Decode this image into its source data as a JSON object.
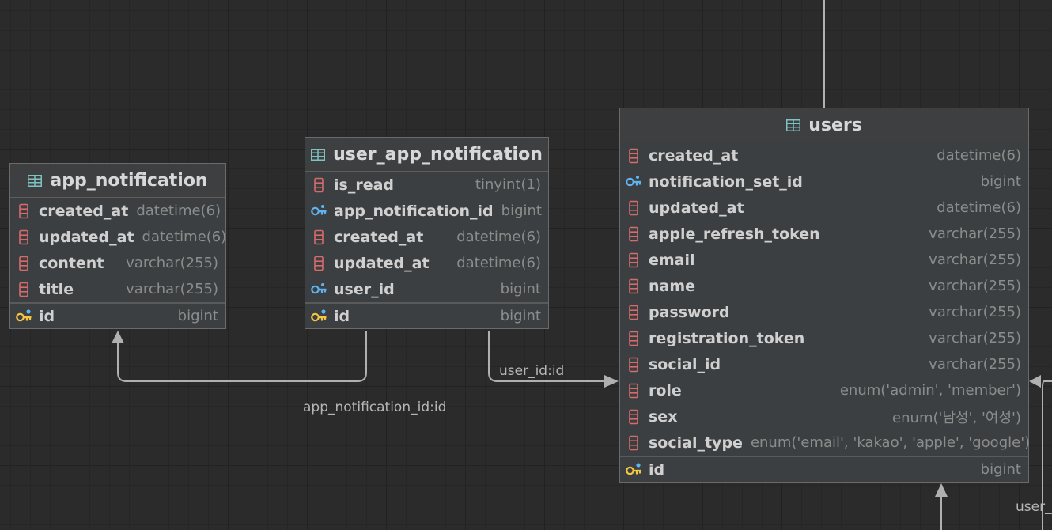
{
  "tables": {
    "app_notification": {
      "title": "app_notification",
      "columns": [
        {
          "name": "created_at",
          "type": "datetime(6)",
          "kind": "column"
        },
        {
          "name": "updated_at",
          "type": "datetime(6)",
          "kind": "column"
        },
        {
          "name": "content",
          "type": "varchar(255)",
          "kind": "column"
        },
        {
          "name": "title",
          "type": "varchar(255)",
          "kind": "column"
        }
      ],
      "pk": {
        "name": "id",
        "type": "bigint"
      }
    },
    "user_app_notification": {
      "title": "user_app_notification",
      "columns": [
        {
          "name": "is_read",
          "type": "tinyint(1)",
          "kind": "column"
        },
        {
          "name": "app_notification_id",
          "type": "bigint",
          "kind": "fk"
        },
        {
          "name": "created_at",
          "type": "datetime(6)",
          "kind": "column"
        },
        {
          "name": "updated_at",
          "type": "datetime(6)",
          "kind": "column"
        },
        {
          "name": "user_id",
          "type": "bigint",
          "kind": "fk"
        }
      ],
      "pk": {
        "name": "id",
        "type": "bigint"
      }
    },
    "users": {
      "title": "users",
      "columns": [
        {
          "name": "created_at",
          "type": "datetime(6)",
          "kind": "column"
        },
        {
          "name": "notification_set_id",
          "type": "bigint",
          "kind": "fk"
        },
        {
          "name": "updated_at",
          "type": "datetime(6)",
          "kind": "column"
        },
        {
          "name": "apple_refresh_token",
          "type": "varchar(255)",
          "kind": "column"
        },
        {
          "name": "email",
          "type": "varchar(255)",
          "kind": "column"
        },
        {
          "name": "name",
          "type": "varchar(255)",
          "kind": "column"
        },
        {
          "name": "password",
          "type": "varchar(255)",
          "kind": "column"
        },
        {
          "name": "registration_token",
          "type": "varchar(255)",
          "kind": "column"
        },
        {
          "name": "social_id",
          "type": "varchar(255)",
          "kind": "column"
        },
        {
          "name": "role",
          "type": "enum('admin', 'member')",
          "kind": "column"
        },
        {
          "name": "sex",
          "type": "enum('남성', '여성')",
          "kind": "column"
        },
        {
          "name": "social_type",
          "type": "enum('email', 'kakao', 'apple', 'google')",
          "kind": "column"
        }
      ],
      "pk": {
        "name": "id",
        "type": "bigint"
      }
    }
  },
  "relations": {
    "user_id_label": "user_id:id",
    "app_notification_id_label": "app_notification_id:id",
    "edge_label": "user_"
  },
  "icons": {
    "table": "table-icon",
    "column": "column-icon",
    "foreign_key": "foreign-key-icon",
    "primary_key": "primary-key-icon"
  },
  "colors": {
    "background": "#2b2b2b",
    "table_icon": "#7ec3c3",
    "column_icon": "#d76a6a",
    "foreign_key_icon": "#5fb3f0",
    "primary_key_icon": "#f5c542"
  }
}
